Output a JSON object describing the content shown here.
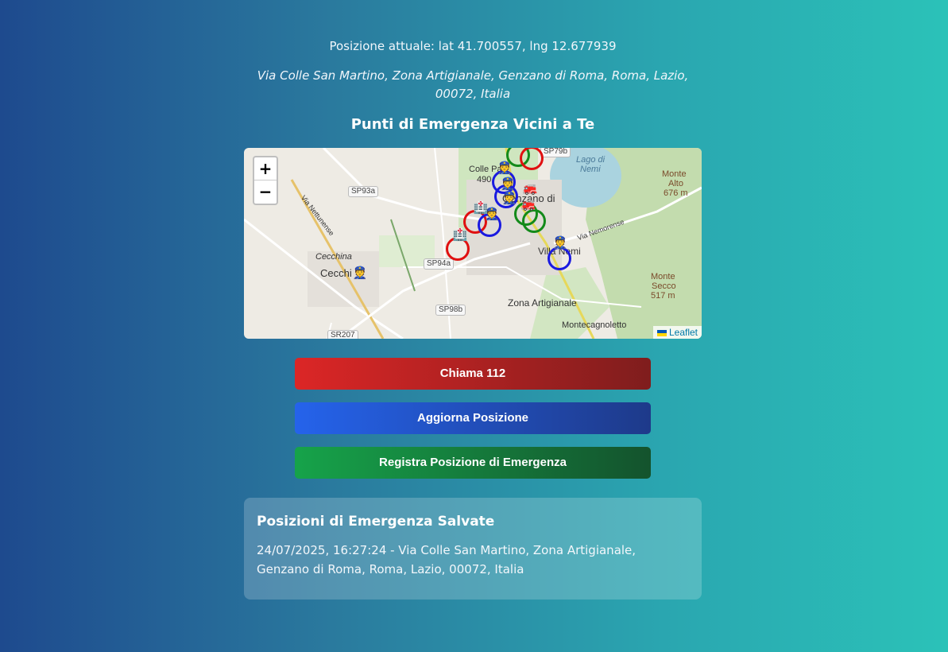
{
  "position": {
    "text": "Posizione attuale: lat 41.700557, lng 12.677939"
  },
  "address": {
    "text": "Via Colle San Martino, Zona Artigianale, Genzano di Roma, Roma, Lazio, 00072, Italia"
  },
  "nearby": {
    "title": "Punti di Emergenza Vicini a Te"
  },
  "map": {
    "zoom_in": "+",
    "zoom_out": "−",
    "attribution": "Leaflet",
    "labels": {
      "cecchina_town": "Cecchina",
      "cecchi": "Cecchi",
      "colle_pa": "Colle Pa",
      "num490": "490",
      "genzano": "Genzano di",
      "lago": "Lago di",
      "nemi_lake": "Nemi",
      "monte_alto": "Monte",
      "monte_alto2": "Alto",
      "monte_alto3": "676 m",
      "monte_secco": "Monte",
      "monte_secco2": "Secco",
      "monte_secco3": "517 m",
      "villa_nemi": "Villa Nemi",
      "zona": "Zona Artigianale",
      "montecagnoletto": "Montecagnoletto",
      "via_nemorense": "Via Nemorense",
      "via_nettunense": "Via Nettunense"
    },
    "roads": {
      "sp93a": "SP93a",
      "sp94a": "SP94a",
      "sp98b": "SP98b",
      "sr207": "SR207",
      "sp79b": "SP79b"
    }
  },
  "buttons": {
    "call": "Chiama 112",
    "update": "Aggiorna Posizione",
    "save": "Registra Posizione di Emergenza"
  },
  "saved": {
    "title": "Posizioni di Emergenza Salvate",
    "entries": [
      "24/07/2025, 16:27:24 - Via Colle San Martino, Zona Artigianale, Genzano di Roma, Roma, Lazio, 00072, Italia"
    ]
  }
}
